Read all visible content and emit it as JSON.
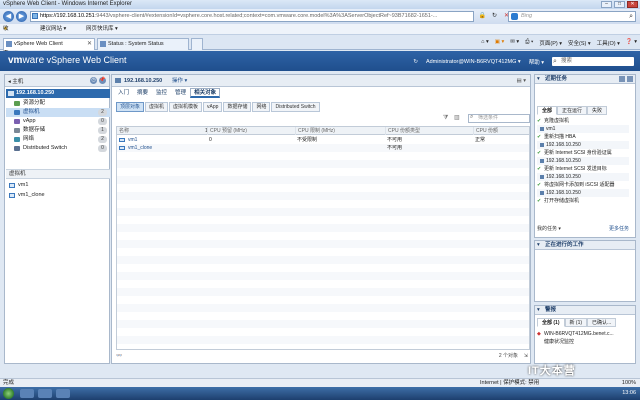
{
  "browser": {
    "title": "vSphere Web Client - Windows Internet Explorer",
    "address_host": "https://192.168.10.251",
    "address_rest": ":9443/vsphere-client/#extensionId=vsphere.core.host.related;context=com.vmware.core.model%3A%3AServerObjectRef~93B71682-1651-...",
    "search_engine": "Bing",
    "favorites_label": "收藏夹",
    "fav_links": [
      "建议网站 ▾",
      "网页快讯库 ▾"
    ],
    "tabs": [
      "vSphere Web Client",
      "Status : System Status"
    ],
    "command_bar": [
      "页面(P) ▾",
      "安全(S) ▾",
      "工具(O) ▾",
      "❓ ▾"
    ]
  },
  "vsphere": {
    "logo_vm": "vm",
    "logo_ware": "ware",
    "logo_product": " vSphere Web Client",
    "home_icon": "home-icon",
    "user": "Administrator@WIN-B6RVQT412MG ▾",
    "help": "帮助 ▾",
    "search_placeholder": "搜索"
  },
  "navigator": {
    "back_label": "◂ 主机",
    "host": "192.168.10.250",
    "items": [
      {
        "label": "资源分配",
        "count": "",
        "color": "#5c9e50"
      },
      {
        "label": "虚拟机",
        "count": "2",
        "color": "#3a78bd"
      },
      {
        "label": "vApp",
        "count": "0",
        "color": "#7a5fb0"
      },
      {
        "label": "数据存储",
        "count": "1",
        "color": "#7b8896"
      },
      {
        "label": "网络",
        "count": "2",
        "color": "#3a8fa8"
      },
      {
        "label": "Distributed Switch",
        "count": "0",
        "color": "#5a7090"
      }
    ],
    "vm_section": "虚拟机",
    "vms": [
      "vm1",
      "vm1_clone"
    ]
  },
  "content": {
    "header_host": "192.168.10.250",
    "actions_label": "操作 ▾",
    "tabs": [
      "入门",
      "摘要",
      "监控",
      "管理",
      "相关对象"
    ],
    "active_tab": 4,
    "subtabs": [
      "顶层对象",
      "虚拟机",
      "虚拟机模板",
      "vApp",
      "数据存储",
      "网络",
      "Distributed Switch"
    ],
    "filter_placeholder": "筛选条件",
    "columns": [
      "名称",
      "1 ▲",
      "CPU 预留 (MHz)",
      "CPU 限制 (MHz)",
      "CPU 份额类型",
      "CPU 份额"
    ],
    "rows": [
      {
        "name": "vm1",
        "cpu_reservation": "0",
        "cpu_limit": "不受限制",
        "share_type": "不可用",
        "share": "正常"
      },
      {
        "name": "vm1_clone",
        "cpu_reservation": "",
        "cpu_limit": "",
        "share_type": "不可用",
        "share": ""
      }
    ],
    "footer_count": "2 个对象",
    "footer_icon": "binoculars-icon"
  },
  "recent_tasks": {
    "title": "近期任务",
    "tabs": [
      "全部",
      "正在运行",
      "失败"
    ],
    "items": [
      {
        "text": "克隆虚拟机",
        "type": "chk"
      },
      {
        "text": "vm1",
        "type": "sub"
      },
      {
        "text": "重新扫描 HBA",
        "type": "chk"
      },
      {
        "text": "192.168.10.250",
        "type": "sub"
      },
      {
        "text": "更新 Internet SCSI 身份验证属",
        "type": "chk"
      },
      {
        "text": "192.168.10.250",
        "type": "sub"
      },
      {
        "text": "更新 Internet SCSI 发送目标",
        "type": "chk"
      },
      {
        "text": "192.168.10.250",
        "type": "sub"
      },
      {
        "text": "将虚拟网卡添加到 iSCSI 适配器",
        "type": "chk"
      },
      {
        "text": "192.168.10.250",
        "type": "sub"
      },
      {
        "text": "打开存储虚拟机",
        "type": "chk"
      }
    ],
    "footer_left": "我的任务 ▾",
    "footer_right": "更多任务"
  },
  "work_in_progress": {
    "title": "正在进行的工作"
  },
  "alarms": {
    "title": "警报",
    "tabs": [
      "全部 (1)",
      "新 (1)",
      "已确认..."
    ],
    "items": [
      "WIN-B6RVQT412MG.benet.c...",
      "健康状况监控"
    ]
  },
  "status_bar": {
    "left": "完成",
    "zone": "Internet | 保护模式: 禁用",
    "zoom": "100%"
  },
  "taskbar": {
    "clock": "13:06"
  },
  "watermark": "IT大本营"
}
